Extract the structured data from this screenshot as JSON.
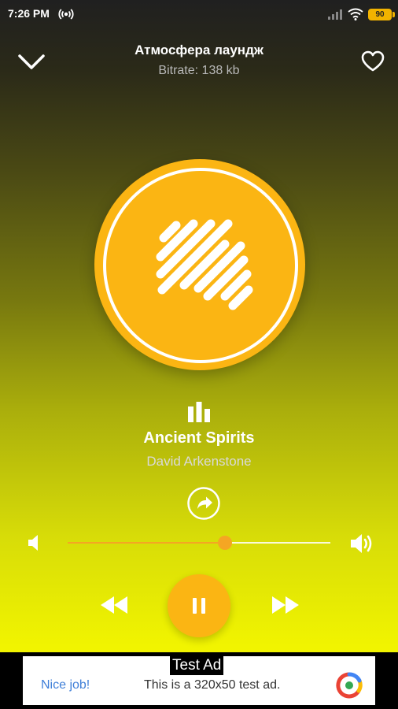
{
  "status_bar": {
    "time": "7:26 PM",
    "battery": "90"
  },
  "header": {
    "station_name": "Атмосфера лаундж",
    "bitrate": "Bitrate: 138 kb"
  },
  "now_playing": {
    "title": "Ancient Spirits",
    "artist": "David Arkenstone"
  },
  "volume": {
    "level": 0.6
  },
  "playback": {
    "state": "playing"
  },
  "ad": {
    "label": "Test Ad",
    "headline": "Nice job!",
    "body": "This is a 320x50 test ad."
  },
  "colors": {
    "accent": "#fbb513",
    "slider": "#f5a623",
    "gradient_top": "#202020",
    "gradient_bottom": "#f7fa00"
  },
  "icons": [
    "chevron-down-icon",
    "heart-icon",
    "equalizer-icon",
    "share-icon",
    "volume-low-icon",
    "volume-high-icon",
    "rewind-icon",
    "pause-icon",
    "fast-forward-icon"
  ]
}
